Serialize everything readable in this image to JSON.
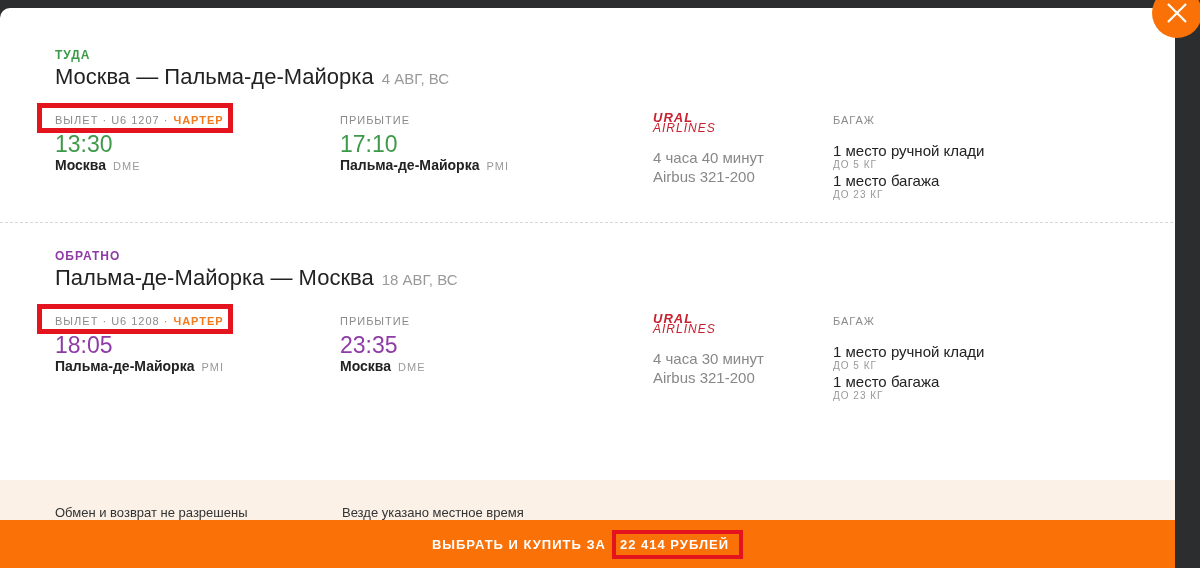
{
  "segments": [
    {
      "direction": "ТУДА",
      "color": "#3c9a48",
      "route": "Москва — Пальма-де-Майорка",
      "date": "4 АВГ, ВС",
      "flight_info": "ВЫЛЕТ · U6 1207 ·",
      "flight_type": "ЧАРТЕР",
      "highlighted": true,
      "departure": {
        "time": "13:30",
        "city": "Москва",
        "code": "DME"
      },
      "arrival": {
        "label": "ПРИБЫТИЕ",
        "time": "17:10",
        "city": "Пальма-де-Майорка",
        "code": "PMI"
      },
      "airline_logo": {
        "line1": "URAL",
        "line2": "AIRLINES"
      },
      "duration": "4 часа 40 минут",
      "aircraft": "Airbus 321-200",
      "baggage": {
        "label": "БАГАЖ",
        "items": [
          {
            "name": "1 место ручной клади",
            "limit": "ДО 5 КГ"
          },
          {
            "name": "1 место багажа",
            "limit": "ДО 23 КГ"
          }
        ]
      }
    },
    {
      "direction": "ОБРАТНО",
      "color": "#8e3ba6",
      "route": "Пальма-де-Майорка — Москва",
      "date": "18 АВГ, ВС",
      "flight_info": "ВЫЛЕТ · U6 1208 ·",
      "flight_type": "ЧАРТЕР",
      "highlighted": true,
      "departure": {
        "time": "18:05",
        "city": "Пальма-де-Майорка",
        "code": "PMI"
      },
      "arrival": {
        "label": "ПРИБЫТИЕ",
        "time": "23:35",
        "city": "Москва",
        "code": "DME"
      },
      "airline_logo": {
        "line1": "URAL",
        "line2": "AIRLINES"
      },
      "duration": "4 часа 30 минут",
      "aircraft": "Airbus 321-200",
      "baggage": {
        "label": "БАГАЖ",
        "items": [
          {
            "name": "1 место ручной клади",
            "limit": "ДО 5 КГ"
          },
          {
            "name": "1 место багажа",
            "limit": "ДО 23 КГ"
          }
        ]
      }
    }
  ],
  "notes": [
    "Обмен и возврат не разрешены",
    "Везде указано местное время"
  ],
  "buy_button": {
    "label": "ВЫБРАТЬ И КУПИТЬ ЗА",
    "price": "22 414 РУБЛЕЙ",
    "price_highlighted": true
  }
}
